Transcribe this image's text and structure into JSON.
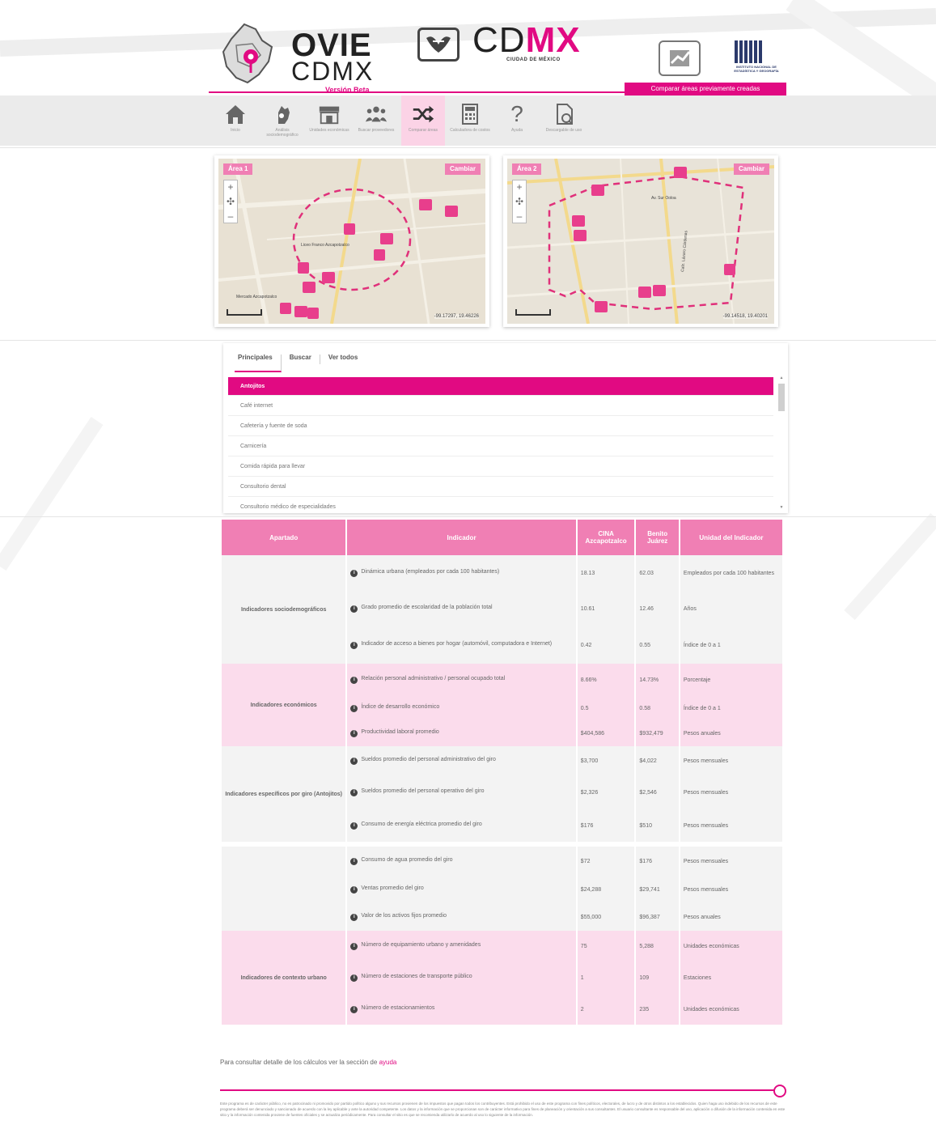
{
  "header": {
    "logo_line1": "OVIE",
    "logo_line2": "CDMX",
    "beta": "Versión Beta",
    "cdmx_main": "CD",
    "cdmx_accent": "MX",
    "cdmx_sub": "CIUDAD DE MÉXICO",
    "compare_tag": "Comparar áreas previamente creadas"
  },
  "nav": {
    "items": [
      {
        "label": "Inicio",
        "icon": "home-icon"
      },
      {
        "label": "Análisis sociodemográfico",
        "icon": "hand-icon"
      },
      {
        "label": "Unidades económicas",
        "icon": "store-icon"
      },
      {
        "label": "Buscar proveedores",
        "icon": "people-icon"
      },
      {
        "label": "Comparar áreas",
        "icon": "shuffle-icon"
      },
      {
        "label": "Calculadora de costos",
        "icon": "calculator-icon"
      },
      {
        "label": "Ayuda",
        "icon": "question-icon"
      },
      {
        "label": "Descargable de uso",
        "icon": "document-icon"
      }
    ]
  },
  "maps": {
    "area1": {
      "tag": "Área 1",
      "change": "Cambiar",
      "coords": "-99.17297, 19.46226",
      "place1": "Liceo Franco Azcapotzalco",
      "place2": "Mercado Azcapotzalco"
    },
    "area2": {
      "tag": "Área 2",
      "change": "Cambiar",
      "coords": "-99.14518, 19.40201",
      "street1": "Av. Sur Ooloa",
      "street2": "Calz. Lázaro Cárdenas"
    }
  },
  "tabs": {
    "items": [
      "Principales",
      "Buscar",
      "Ver todos"
    ]
  },
  "list": {
    "items": [
      "Antojitos",
      "Café internet",
      "Cafetería y fuente de soda",
      "Carnicería",
      "Comida rápida para llevar",
      "Consultorio dental",
      "Consultorio médico de especialidades"
    ]
  },
  "table": {
    "headers": [
      "Apartado",
      "Indicador",
      "CINA Azcapotzalco",
      "Benito Juárez",
      "Unidad del Indicador"
    ],
    "sections": [
      {
        "name": "Indicadores sociodemográficos",
        "style": "grey",
        "rows": [
          {
            "ind": "Dinámica urbana (empleados por cada 100 habitantes)",
            "a": "18.13",
            "b": "62.03",
            "u": "Empleados por cada 100 habitantes"
          },
          {
            "ind": "Grado promedio de escolaridad de la población total",
            "a": "10.61",
            "b": "12.46",
            "u": "Años"
          },
          {
            "ind": "Indicador de acceso a bienes por hogar (automóvil, computadora e Internet)",
            "a": "0.42",
            "b": "0.55",
            "u": "Índice de 0 a 1"
          }
        ]
      },
      {
        "name": "Indicadores económicos",
        "style": "pink",
        "rows": [
          {
            "ind": "Relación personal administrativo / personal ocupado total",
            "a": "8.66%",
            "b": "14.73%",
            "u": "Porcentaje"
          },
          {
            "ind": "Índice de desarrollo económico",
            "a": "0.5",
            "b": "0.58",
            "u": "Índice de 0 a 1"
          },
          {
            "ind": "Productividad laboral promedio",
            "a": "$404,586",
            "b": "$932,479",
            "u": "Pesos anuales"
          }
        ]
      },
      {
        "name": "Indicadores específicos por giro (Antojitos)",
        "style": "grey",
        "rows": [
          {
            "ind": "Sueldos promedio del personal administrativo del giro",
            "a": "$3,700",
            "b": "$4,022",
            "u": "Pesos mensuales"
          },
          {
            "ind": "Sueldos promedio del personal operativo del giro",
            "a": "$2,326",
            "b": "$2,546",
            "u": "Pesos mensuales"
          },
          {
            "ind": "Consumo de energía eléctrica promedio del giro",
            "a": "$176",
            "b": "$510",
            "u": "Pesos mensuales"
          }
        ]
      },
      {
        "name": "",
        "style": "grey",
        "rows": [
          {
            "ind": "Consumo de agua promedio del giro",
            "a": "$72",
            "b": "$176",
            "u": "Pesos mensuales"
          },
          {
            "ind": "Ventas promedio del giro",
            "a": "$24,288",
            "b": "$29,741",
            "u": "Pesos mensuales"
          },
          {
            "ind": "Valor de los activos fijos promedio",
            "a": "$55,000",
            "b": "$96,387",
            "u": "Pesos anuales"
          }
        ]
      },
      {
        "name": "Indicadores de contexto urbano",
        "style": "pink",
        "rows": [
          {
            "ind": "Número de equipamiento urbano y amenidades",
            "a": "75",
            "b": "5,288",
            "u": "Unidades económicas"
          },
          {
            "ind": "Número de estaciones de transporte público",
            "a": "1",
            "b": "109",
            "u": "Estaciones"
          },
          {
            "ind": "Número de estacionamientos",
            "a": "2",
            "b": "235",
            "u": "Unidades económicas"
          }
        ]
      }
    ]
  },
  "footnote": {
    "text": "Para consultar detalle de los cálculos ver la sección de ",
    "link": "ayuda"
  },
  "disclaimer": "Este programa es de carácter público, no es patrocinado ni promovido por partido político alguno y sus recursos provienen de los impuestos que pagan todos los contribuyentes. Está prohibido el uso de este programa con fines políticos, electorales, de lucro y de otros distintos a los establecidos. Quien haga uso indebido de los recursos de este programa deberá ser denunciado y sancionado de acuerdo con la ley aplicable y ante la autoridad competente. Los datos y la información que se proporcionan son de carácter informativo para fines de planeación y orientación a sus consultantes. El usuario consultante es responsable del uso, aplicación o difusión de la información contenida en este sitio y la información contenida proviene de fuentes oficiales y se actualiza periódicamente. Para consultar el sitio es que se recomienda utilizarlo de acuerdo al uso lo siguiente de la información."
}
